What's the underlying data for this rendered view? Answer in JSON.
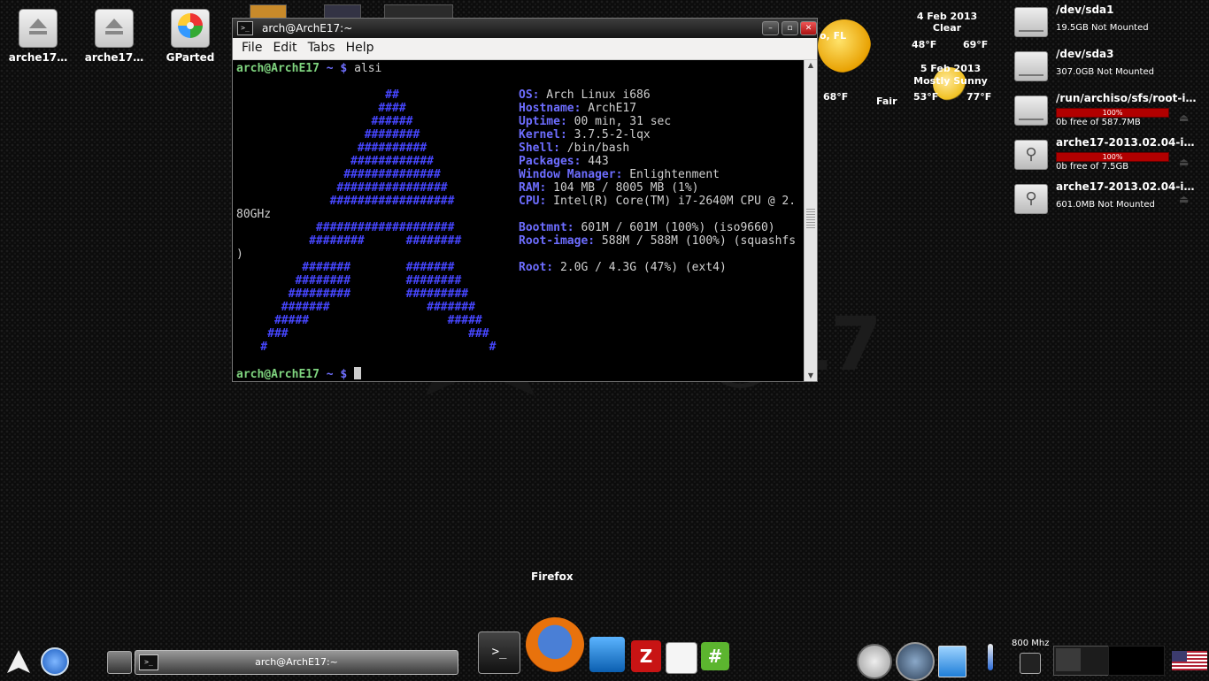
{
  "desktop": {
    "icons": [
      {
        "label": "arche17…",
        "icon": "eject-icon"
      },
      {
        "label": "arche17…",
        "icon": "eject-icon"
      },
      {
        "label": "GParted",
        "icon": "gparted-icon"
      }
    ],
    "watermark": {
      "text": "arch",
      "text2": "17"
    }
  },
  "terminal": {
    "title": "arch@ArchE17:~",
    "menu": [
      "File",
      "Edit",
      "Tabs",
      "Help"
    ],
    "prompt_user": "arch@ArchE17",
    "prompt_tail": " ~ $ ",
    "command": "alsi",
    "wrap1": "80GHz",
    "wrap2": ")",
    "art": [
      "                      ##",
      "                     ####",
      "                    ######",
      "                   ########",
      "                  ##########",
      "                 ############",
      "                ##############",
      "               ################",
      "              ##################",
      "",
      "            ####################",
      "           ########      ########",
      "",
      "          #######        #######",
      "         ########        ########",
      "        #########        #########",
      "       #######              #######",
      "      #####                    #####",
      "     ###                          ###",
      "    #                                #"
    ],
    "info": [
      {
        "k": "OS:",
        "v": " Arch Linux i686"
      },
      {
        "k": "Hostname:",
        "v": " ArchE17"
      },
      {
        "k": "Uptime:",
        "v": " 00 min, 31 sec"
      },
      {
        "k": "Kernel:",
        "v": " 3.7.5-2-lqx"
      },
      {
        "k": "Shell:",
        "v": " /bin/bash"
      },
      {
        "k": "Packages:",
        "v": " 443"
      },
      {
        "k": "Window Manager:",
        "v": " Enlightenment"
      },
      {
        "k": "RAM:",
        "v": " 104 MB / 8005 MB (1%)"
      },
      {
        "k": "CPU:",
        "v": " Intel(R) Core(TM) i7-2640M CPU @ 2."
      },
      {
        "k": "",
        "v": ""
      },
      {
        "k": "Bootmnt:",
        "v": " 601M / 601M (100%) (iso9660)"
      },
      {
        "k": "Root-image:",
        "v": " 588M / 588M (100%) (squashfs"
      },
      {
        "k": "",
        "v": ""
      },
      {
        "k": "Root:",
        "v": " 2.0G / 4.3G (47%) (ext4)"
      }
    ]
  },
  "weather": {
    "current": {
      "location": "o, FL",
      "temp": "68°F",
      "cond": "Fair"
    },
    "forecast": [
      {
        "date": "4 Feb 2013",
        "cond": "Clear",
        "low": "48°F",
        "high": "69°F"
      },
      {
        "date": "5 Feb 2013",
        "cond": "Mostly Sunny",
        "low": "53°F",
        "high": "77°F"
      }
    ]
  },
  "devices": [
    {
      "name": "/dev/sda1",
      "info": "19.5GB Not Mounted",
      "bar": null,
      "kind": "hdd"
    },
    {
      "name": "/dev/sda3",
      "info": "307.0GB Not Mounted",
      "bar": null,
      "kind": "hdd"
    },
    {
      "name": "/run/archiso/sfs/root-i…",
      "info": "0b free of 587.7MB",
      "bar": "100%",
      "usage": 1.0,
      "kind": "hdd"
    },
    {
      "name": "arche17-2013.02.04-i…",
      "info": "0b free of 7.5GB",
      "bar": "100%",
      "usage": 1.0,
      "kind": "usb"
    },
    {
      "name": "arche17-2013.02.04-i…",
      "info": "601.0MB Not Mounted",
      "bar": null,
      "kind": "usb"
    }
  ],
  "shelf": {
    "taskbar_item": "arch@ArchE17:~",
    "tooltip": "Firefox",
    "cpufreq": "800 Mhz",
    "dock": [
      "terminal-icon",
      "firefox-icon",
      "wireshark-icon",
      "filezilla-icon",
      "text-editor-icon",
      "hashtag-icon"
    ]
  },
  "colors": {
    "accent": "#4646ff",
    "prompt": "#7fd47f",
    "usage_bar": "#b10000"
  }
}
